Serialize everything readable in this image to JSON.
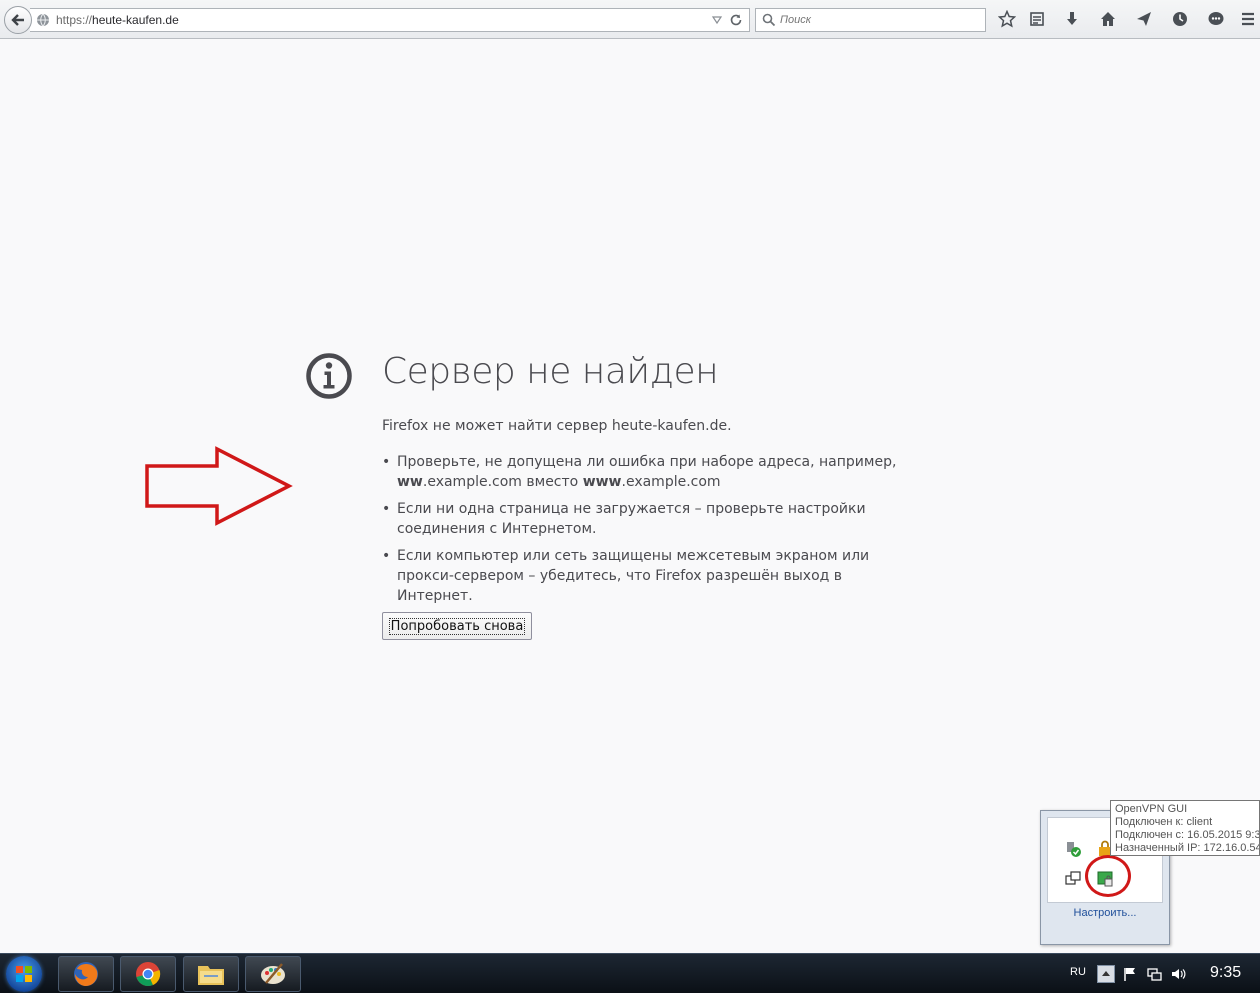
{
  "browser": {
    "url_protocol": "https://",
    "url_host": "heute-kaufen.de",
    "search_placeholder": "Поиск"
  },
  "error_page": {
    "title": "Сервер не найден",
    "description": "Firefox не может найти сервер heute-kaufen.de.",
    "tips": [
      {
        "line1": "Проверьте, не допущена ли ошибка при наборе адреса, например,",
        "bad_prefix": "ww",
        "bad_rest": ".example.com вместо ",
        "good_prefix": "www",
        "good_rest": ".example.com"
      },
      {
        "text": "Если ни одна страница не загружается – проверьте настройки соединения с Интернетом."
      },
      {
        "text": "Если компьютер или сеть защищены межсетевым экраном или прокси-сервером – убедитесь, что Firefox разрешён выход в Интернет."
      }
    ],
    "retry_label": "Попробовать снова"
  },
  "tray_popup": {
    "customize_label": "Настроить..."
  },
  "vpn_tooltip": {
    "lines": [
      "OpenVPN GUI",
      "Подключен к: client",
      "Подключен с: 16.05.2015 9:3",
      "Назначенный IP: 172.16.0.54"
    ]
  },
  "taskbar": {
    "language": "RU",
    "clock": "9:35"
  },
  "colors": {
    "annotation_red": "#d01818",
    "page_background": "#f9f9fa",
    "text": "#4a4a4f"
  }
}
